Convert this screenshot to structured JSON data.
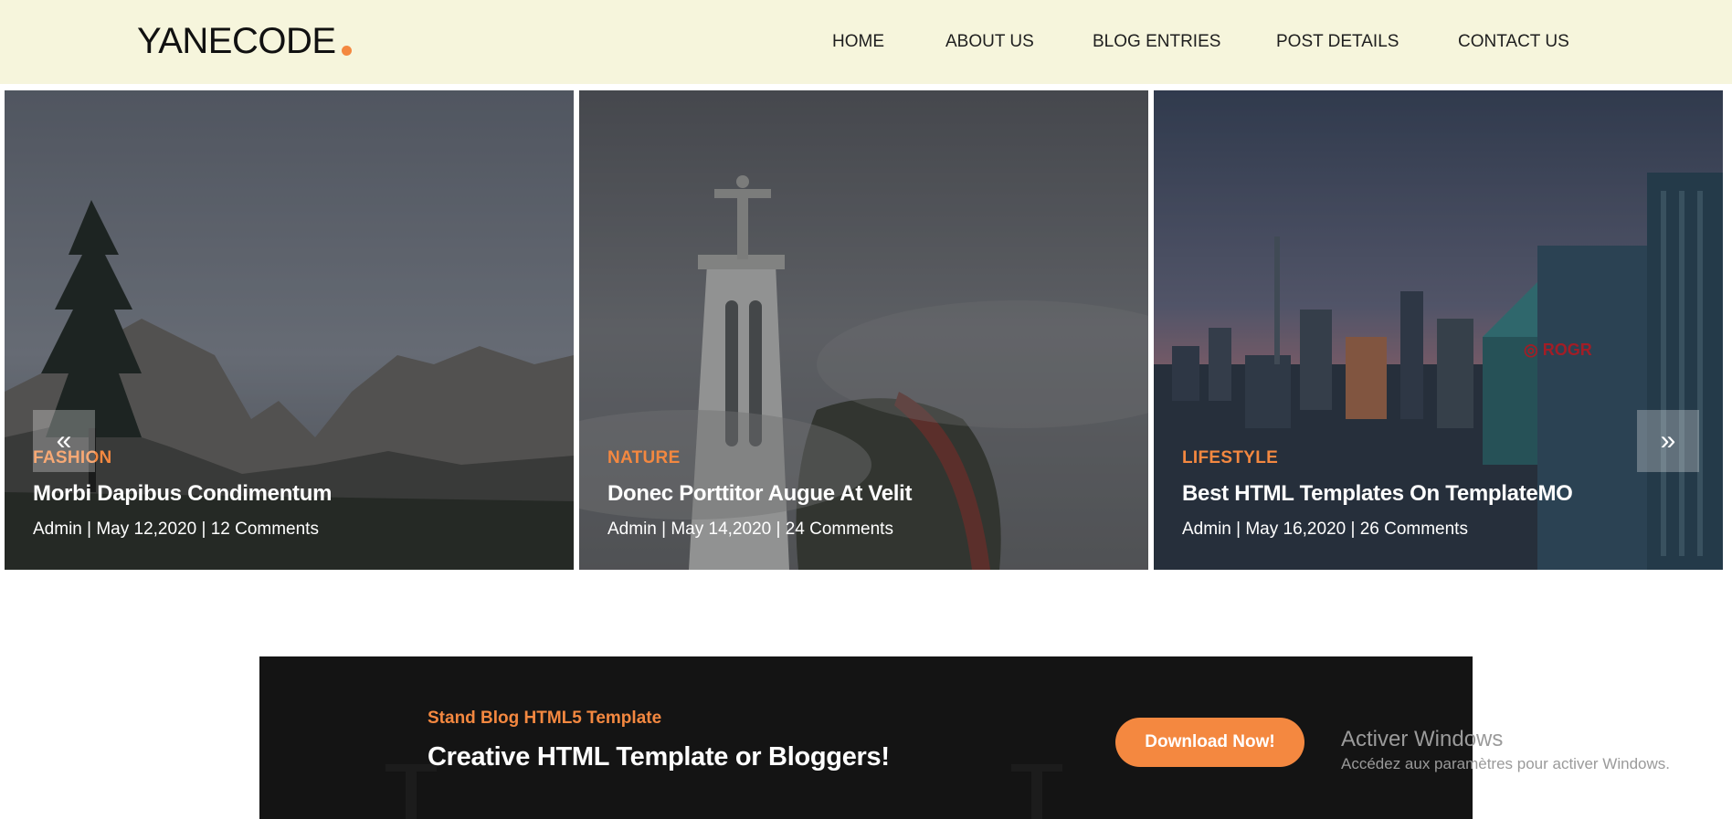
{
  "header": {
    "logo": "YANECODE",
    "nav": [
      "HOME",
      "ABOUT US",
      "BLOG ENTRIES",
      "POST DETAILS",
      "CONTACT US"
    ]
  },
  "slider": {
    "prev_icon": "«",
    "next_icon": "»",
    "slides": [
      {
        "category": "FASHION",
        "title": "Morbi Dapibus Condimentum",
        "meta": "Admin | May 12,2020 | 12 Comments"
      },
      {
        "category": "NATURE",
        "title": "Donec Porttitor Augue At Velit",
        "meta": "Admin | May 14,2020 | 24 Comments"
      },
      {
        "category": "LIFESTYLE",
        "title": "Best HTML Templates On TemplateMO",
        "meta": "Admin | May 16,2020 | 26 Comments"
      }
    ]
  },
  "cta": {
    "subtitle": "Stand Blog HTML5 Template",
    "title": "Creative HTML Template or Bloggers!",
    "button": "Download Now!"
  },
  "watermark": {
    "title": "Activer Windows",
    "subtitle": "Accédez aux paramètres pour activer Windows."
  },
  "colors": {
    "header_bg": "#f6f5dc",
    "accent": "#f48840",
    "cta_bg": "#141414"
  },
  "icons": [
    "chevron-double-left-icon",
    "chevron-double-right-icon"
  ]
}
